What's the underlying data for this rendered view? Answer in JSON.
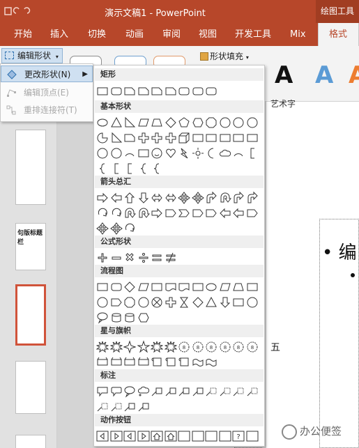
{
  "window": {
    "title": "演示文稿1  -  PowerPoint",
    "contextual_tab": "绘图工具"
  },
  "ribbon_tabs": [
    "开始",
    "插入",
    "切换",
    "动画",
    "审阅",
    "视图",
    "开发工具",
    "Mix",
    "格式"
  ],
  "ribbon": {
    "edit_shape_label": "编辑形状",
    "shape_fill_label": "形状填充",
    "wordart_glyph": "A",
    "wordart_group_label": "艺术字"
  },
  "edit_shape_menu": {
    "items": [
      {
        "label": "更改形状(N)",
        "enabled": true,
        "submenu": true,
        "icon": "change-shape-icon"
      },
      {
        "label": "编辑顶点(E)",
        "enabled": false,
        "icon": "edit-points-icon"
      },
      {
        "label": "重排连接符(T)",
        "enabled": false,
        "icon": "reroute-connectors-icon"
      }
    ]
  },
  "shape_gallery": {
    "categories": [
      "矩形",
      "基本形状",
      "箭头总汇",
      "公式形状",
      "流程图",
      "星与旗帜",
      "标注",
      "动作按钮"
    ]
  },
  "slide": {
    "bullet": "• 编",
    "text_fragment": "五"
  },
  "thumbnails": {
    "slide2_text": "句版标题栏"
  },
  "watermark": "办公便签",
  "colors": {
    "accent": "#b7472a",
    "selection": "#cfe0f1",
    "thumb_selected": "#d0533a"
  }
}
